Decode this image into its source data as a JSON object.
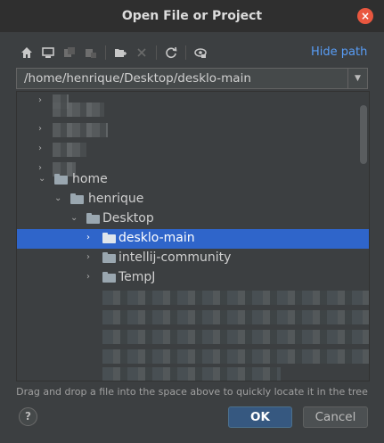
{
  "dialog": {
    "title": "Open File or Project",
    "close_glyph": "×"
  },
  "toolbar": {
    "buttons": [
      "home-icon",
      "desktop-icon",
      "project-icon",
      "module-icon",
      "new-folder-icon",
      "delete-icon",
      "refresh-icon",
      "show-hidden-icon"
    ],
    "hide_path_label": "Hide path"
  },
  "path_field": {
    "value": "/home/henrique/Desktop/desklo-main",
    "dropdown_glyph": "▼"
  },
  "tree": {
    "items": [
      {
        "label": "home",
        "expanded": true
      },
      {
        "label": "henrique",
        "expanded": true
      },
      {
        "label": "Desktop",
        "expanded": true
      },
      {
        "label": "desklo-main",
        "expanded": false,
        "selected": true
      },
      {
        "label": "intellij-community",
        "expanded": false
      },
      {
        "label": "TempJ",
        "expanded": false
      }
    ],
    "arrow_collapsed": "›",
    "arrow_expanded": "⌄"
  },
  "footer": {
    "hint": "Drag and drop a file into the space above to quickly locate it in the tree",
    "help_label": "?",
    "ok_label": "OK",
    "cancel_label": "Cancel"
  },
  "colors": {
    "selection": "#2f65ca",
    "link": "#589df6",
    "close": "#e9573f",
    "ok_button": "#365880"
  }
}
